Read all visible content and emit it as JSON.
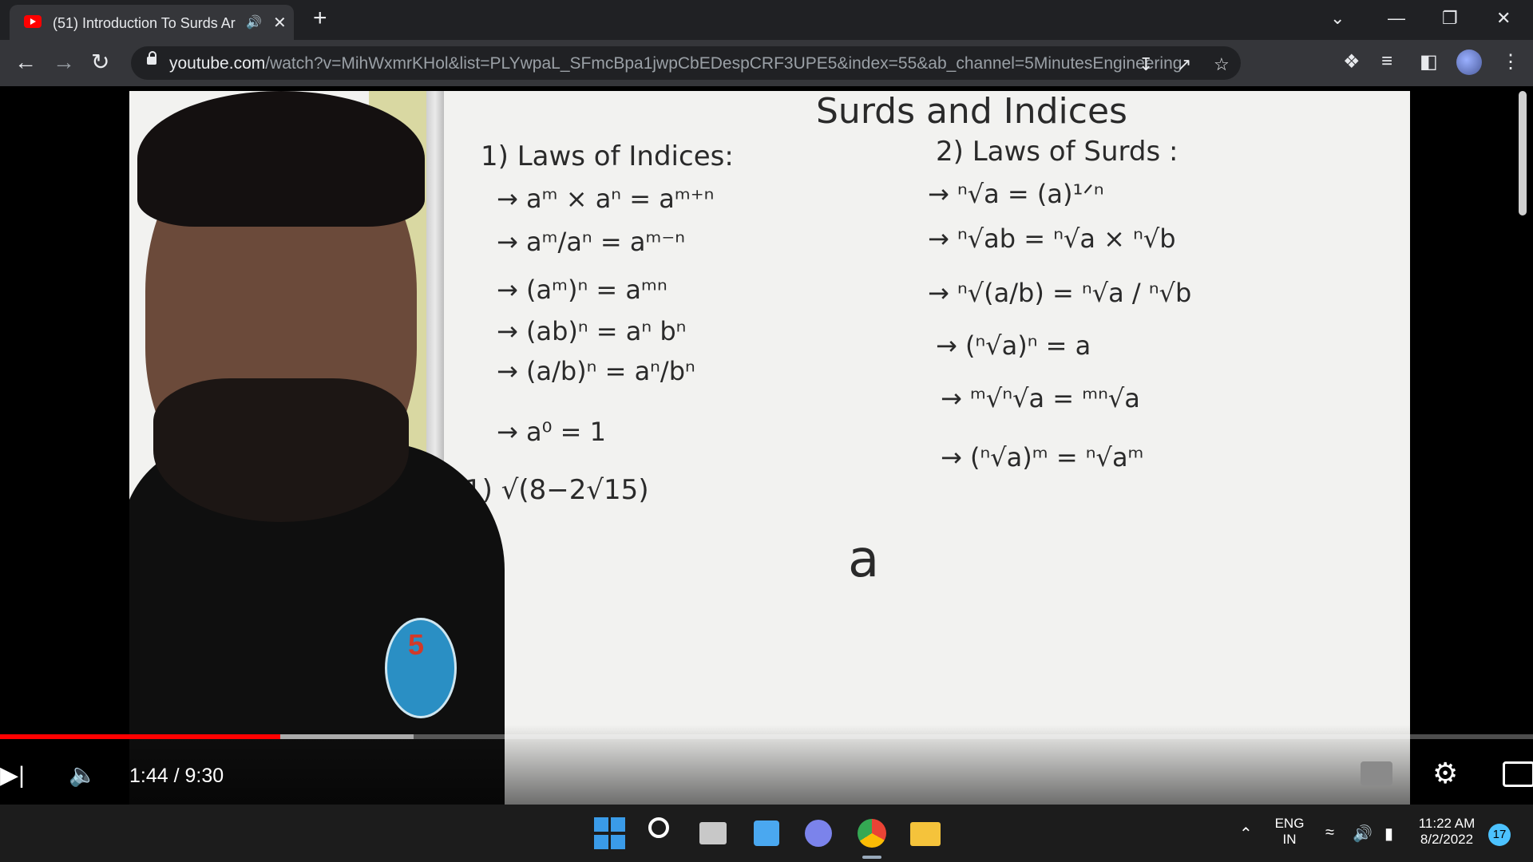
{
  "browser": {
    "tab_title": "(51) Introduction To Surds Ar",
    "url_host": "youtube.com",
    "url_rest": "/watch?v=MihWxmrKHol&list=PLYwpaL_SFmcBpa1jwpCbEDespCRF3UPE5&index=55&ab_channel=5MinutesEngineering",
    "icons": [
      "back-arrow-icon",
      "forward-arrow-icon",
      "reload-icon",
      "lock-icon",
      "install-icon",
      "share-icon",
      "star-icon",
      "extensions-icon",
      "reading-list-icon",
      "side-panel-icon",
      "profile-avatar",
      "kebab-menu-icon"
    ]
  },
  "video": {
    "board": {
      "title": "Surds  and  Indices",
      "left_heading": "1) Laws  of  Indices:",
      "left_rules": [
        "→  aᵐ × aⁿ = aᵐ⁺ⁿ",
        "→  aᵐ/aⁿ = aᵐ⁻ⁿ",
        "→  (aᵐ)ⁿ = aᵐⁿ",
        "→  (ab)ⁿ = aⁿ bⁿ",
        "→  (a/b)ⁿ = aⁿ/bⁿ",
        "→  a⁰ = 1"
      ],
      "example": "1) √(8−2√15)",
      "right_heading": "2) Laws  of  Surds :",
      "right_rules": [
        "→  ⁿ√a = (a)¹ᐟⁿ",
        "→  ⁿ√ab = ⁿ√a × ⁿ√b",
        "→  ⁿ√(a/b) = ⁿ√a / ⁿ√b",
        "→  (ⁿ√a)ⁿ = a",
        "→  ᵐ√ⁿ√a = ᵐⁿ√a",
        "→  (ⁿ√a)ᵐ = ⁿ√aᵐ"
      ],
      "scribble": "a",
      "badge_number": "5"
    },
    "time": "1:44 / 9:30",
    "progress_played": 0.183,
    "progress_buffered": 0.27,
    "colors": {
      "played": "#ff0000",
      "accent": "#ff0000"
    }
  },
  "taskbar": {
    "apps": [
      "start-icon",
      "search-icon",
      "task-view-icon",
      "widgets-icon",
      "teams-chat-icon",
      "chrome-icon",
      "file-explorer-icon"
    ],
    "lang_line1": "ENG",
    "lang_line2": "IN",
    "time": "11:22 AM",
    "date": "8/2/2022",
    "notifications": "17"
  }
}
